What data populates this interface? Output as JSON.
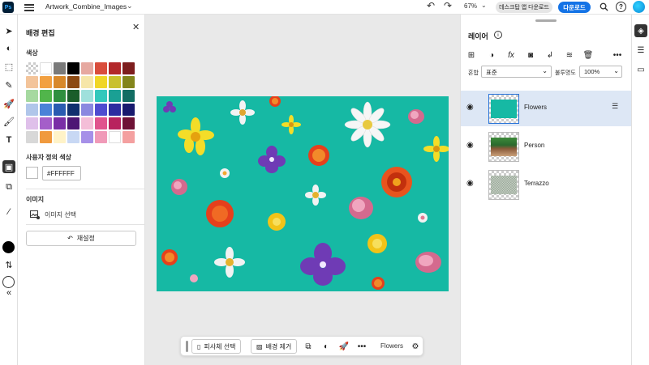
{
  "app": {
    "logo": "Ps",
    "document_title": "Artwork_Combine_Images"
  },
  "toolbar": {
    "zoom": "67%",
    "desktop_button": "데스크탑 앱 다운로드",
    "download_button": "다운로드"
  },
  "properties": {
    "title": "배경 편집",
    "color_section": "색상",
    "custom_color_section": "사용자 정의 색상",
    "custom_color_hex": "#FFFFFF",
    "image_section": "이미지",
    "image_select": "이미지 선택",
    "reset_button": "재설정",
    "swatch_colors": [
      "check",
      "#ffffff",
      "#7a7a7a",
      "#000000",
      "#e6a8a0",
      "#d94d3c",
      "#b2282a",
      "#7d1d1d",
      "#f3c49a",
      "#f2a040",
      "#d8882a",
      "#8c4a13",
      "#f6e6a8",
      "#f0d626",
      "#c9c12d",
      "#83851c",
      "#a6d9a0",
      "#51b54b",
      "#2f8f3f",
      "#1a5d2a",
      "#9fe0dc",
      "#33c8bc",
      "#1aa094",
      "#126d63",
      "#b0c6ea",
      "#4a82d8",
      "#2a5bb1",
      "#0f2f6e",
      "#8a88e0",
      "#4e4bd0",
      "#2d2ca0",
      "#181a6e",
      "#dfc0ea",
      "#a45ec9",
      "#7a2ea6",
      "#4e1674",
      "#f4bed8",
      "#e0538e",
      "#b8235e",
      "#6e1236",
      "#d8d8d8",
      "#f09a3e",
      "#fff3c8",
      "#c8d8f4",
      "#a690e8",
      "#f09ab8",
      "#ffffff",
      "#f4a0a0"
    ]
  },
  "taskbar": {
    "subject_button": "피사체 선택",
    "remove_bg_button": "배경 제거",
    "layer_name": "Flowers"
  },
  "layers": {
    "title": "레이어",
    "blend_label": "혼합",
    "blend_value": "표준",
    "opacity_label": "불투명도",
    "opacity_value": "100%",
    "items": [
      {
        "name": "Flowers",
        "selected": true
      },
      {
        "name": "Person",
        "selected": false
      },
      {
        "name": "Terrazzo",
        "selected": false
      }
    ]
  },
  "colors": {
    "accent": "#1473e6",
    "canvas_bg": "#16b9a4",
    "selected_row": "#dde7f5"
  }
}
